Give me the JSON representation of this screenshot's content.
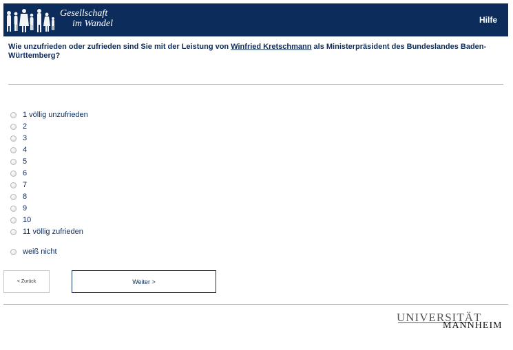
{
  "header": {
    "logo_line1": "Gesellschaft",
    "logo_line2": "im Wandel",
    "help_label": "Hilfe"
  },
  "question": {
    "text_before": "Wie unzufrieden oder zufrieden sind Sie mit der Leistung von ",
    "person": "Winfried Kretschmann",
    "text_after": " als Ministerpräsident des Bundeslandes Baden-Württemberg?"
  },
  "options": [
    "1 völlig unzufrieden",
    "2",
    "3",
    "4",
    "5",
    "6",
    "7",
    "8",
    "9",
    "10",
    "11 völlig zufrieden",
    "weiß nicht"
  ],
  "nav": {
    "back_label": "< Zurück",
    "next_label": "Weiter >"
  },
  "footer": {
    "uni_top": "UNIVERSITÄT",
    "uni_bottom": "MANNHEIM"
  },
  "colors": {
    "brand_navy": "#0c2d5c",
    "text_navy": "#0c2a5a",
    "divider": "#a8a8a8"
  }
}
